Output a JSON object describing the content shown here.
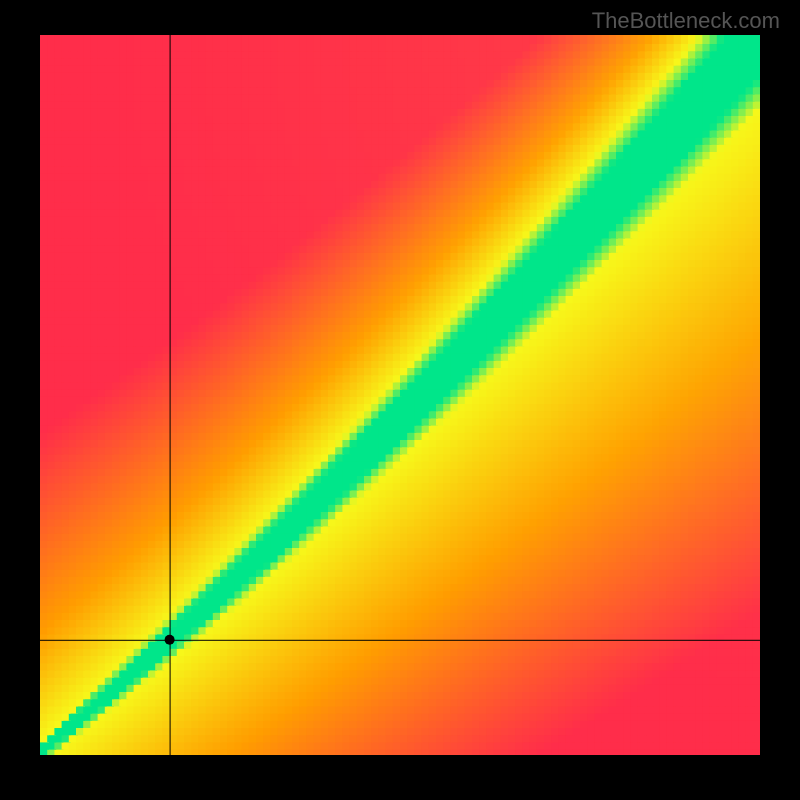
{
  "watermark": "TheBottleneck.com",
  "chart_data": {
    "type": "heatmap",
    "title": "",
    "xlabel": "",
    "ylabel": "",
    "xlim": [
      0,
      100
    ],
    "ylim": [
      0,
      100
    ],
    "grid_size": 100,
    "description": "Bottleneck compatibility heatmap with diagonal green optimal zone",
    "color_scale": {
      "optimal_color": "#00e68a",
      "near_optimal_color": "#f7f71a",
      "moderate_color": "#ff9d00",
      "poor_color": "#ff2d4a"
    },
    "optimal_curve": {
      "description": "Diagonal band from bottom-left to top-right, slightly super-linear",
      "band_width_fraction": 0.08
    },
    "crosshair": {
      "x": 18,
      "y": 16,
      "marker": "dot"
    }
  }
}
